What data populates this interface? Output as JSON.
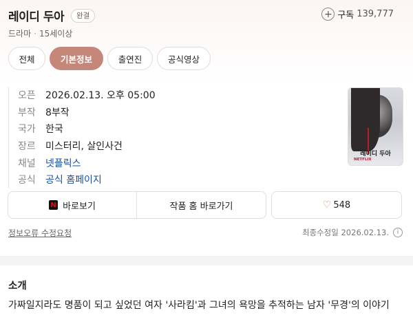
{
  "header": {
    "title": "레이디 두아",
    "badge": "완결",
    "genre": "드라마",
    "separator": "·",
    "rating": "15세이상",
    "subscribe_label": "구독",
    "subscribe_count": "139,777"
  },
  "tabs": [
    {
      "label": "전체",
      "active": false
    },
    {
      "label": "기본정보",
      "active": true
    },
    {
      "label": "출연진",
      "active": false
    },
    {
      "label": "공식영상",
      "active": false
    }
  ],
  "info": [
    {
      "key": "오픈",
      "value": "2026.02.13. 오후 05:00"
    },
    {
      "key": "부작",
      "value": "8부작"
    },
    {
      "key": "국가",
      "value": "한국"
    },
    {
      "key": "장르",
      "value": "미스터리, 살인사건"
    },
    {
      "key": "채널",
      "value": "넷플릭스"
    },
    {
      "key": "공식",
      "value": "공식 홈페이지"
    }
  ],
  "poster": {
    "title_text": "레이디 두아",
    "network_text": "NETFLIX"
  },
  "actions": {
    "watch_label": "바로보기",
    "home_label": "작품 홈 바로가기",
    "like_count": "548"
  },
  "footer": {
    "report_label": "정보오류 수정요청",
    "updated_text": "최종수정일 2026.02.13."
  },
  "intro": {
    "title": "소개",
    "text": "가짜일지라도 명품이 되고 싶었던 여자 '사라킴'과 그녀의 욕망을 추적하는 남자 '무경'의 이야기"
  },
  "colors": {
    "accent": "#c4877a",
    "link": "#1a4fa0"
  }
}
